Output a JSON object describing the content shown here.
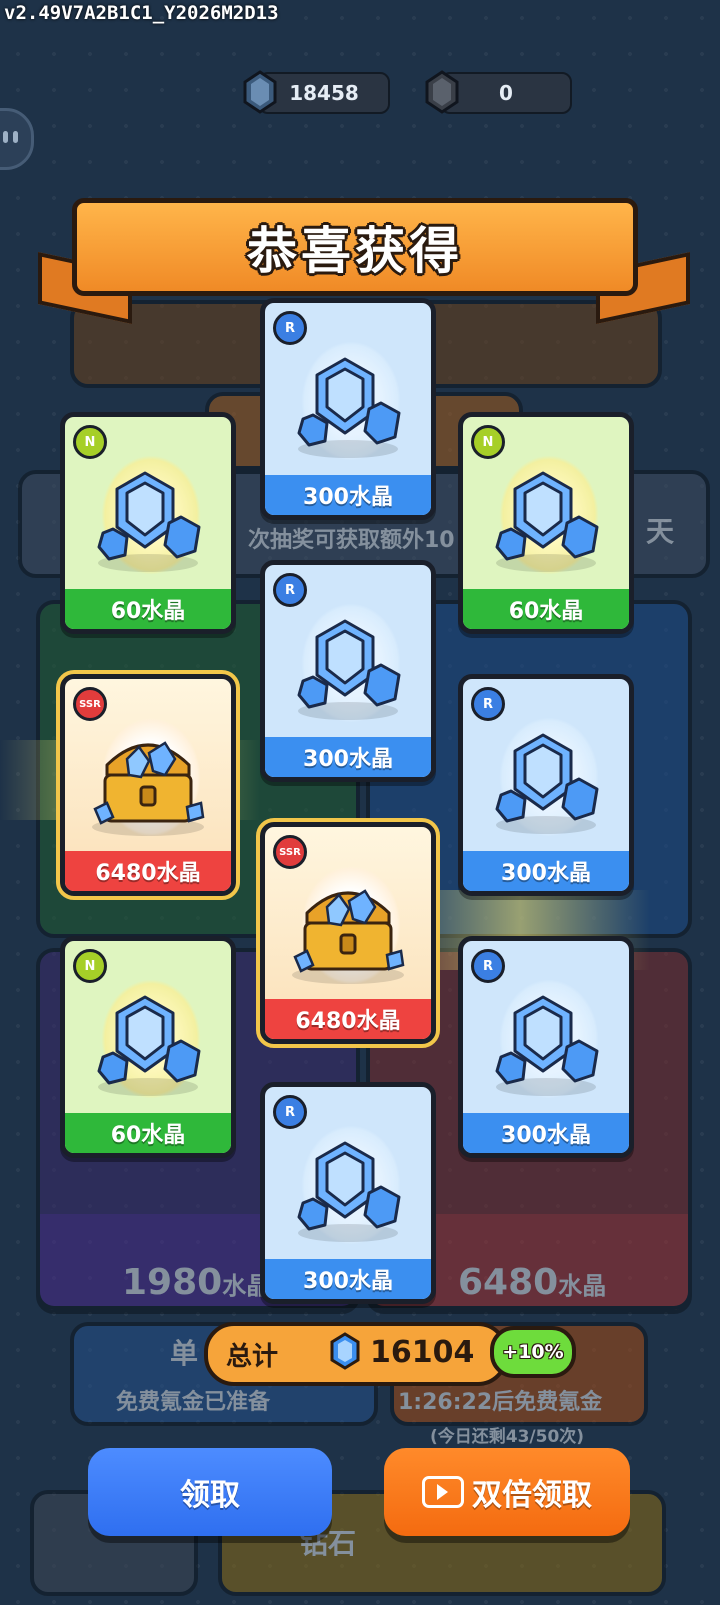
{
  "version": "v2.49V7A2B1C1_Y2026M2D13",
  "currencies": {
    "crystal": "18458",
    "dark_crystal": "0"
  },
  "banner": {
    "title": "恭喜获得"
  },
  "cards": [
    {
      "rarity": "N",
      "label": "60水晶",
      "item": "crystal"
    },
    {
      "rarity": "R",
      "label": "300水晶",
      "item": "crystal"
    },
    {
      "rarity": "N",
      "label": "60水晶",
      "item": "crystal"
    },
    {
      "rarity": "R",
      "label": "300水晶",
      "item": "crystal"
    },
    {
      "rarity": "SSR",
      "label": "6480水晶",
      "item": "treasure-chest"
    },
    {
      "rarity": "R",
      "label": "300水晶",
      "item": "crystal"
    },
    {
      "rarity": "SSR",
      "label": "6480水晶",
      "item": "treasure-chest"
    },
    {
      "rarity": "N",
      "label": "60水晶",
      "item": "crystal"
    },
    {
      "rarity": "R",
      "label": "300水晶",
      "item": "crystal"
    },
    {
      "rarity": "R",
      "label": "300水晶",
      "item": "crystal"
    }
  ],
  "total": {
    "label": "总计",
    "value": "16104",
    "bonus": "+10%"
  },
  "buttons": {
    "claim": "领取",
    "double_claim": "双倍领取"
  },
  "background": {
    "hint_text": "次抽奖可获取额外10",
    "day_text": "天",
    "left_pack_value": "1980",
    "right_pack_value": "6480",
    "pack_unit": "水晶",
    "single_draw": "单",
    "free_ready": "免费氪金已准备",
    "free_timer": "1:26:22后免费氪金",
    "daily_remaining": "(今日还剩43/50次)",
    "diamond": "钻石"
  },
  "colors": {
    "background": "#1e3248",
    "banner": "#f6a43a",
    "rarity_N": "#2fb83a",
    "rarity_R": "#3b8ff0",
    "rarity_SSR": "#ee4340",
    "claim_button": "#2f6ff0",
    "double_button": "#f46b10"
  }
}
